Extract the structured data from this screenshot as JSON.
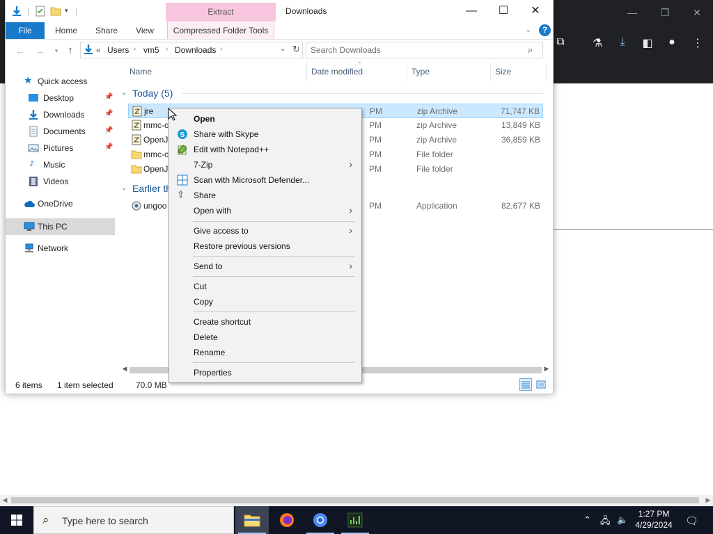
{
  "explorer": {
    "window_title": "Downloads",
    "contextual_tab_header": "Extract",
    "ribbon_tabs": [
      "File",
      "Home",
      "Share",
      "View",
      "Compressed Folder Tools"
    ],
    "help": "?",
    "address": {
      "prefix": "«",
      "segments": [
        "Users",
        "vm5",
        "Downloads"
      ]
    },
    "search_placeholder": "Search Downloads",
    "nav": {
      "quick_access": "Quick access",
      "items": [
        "Desktop",
        "Downloads",
        "Documents",
        "Pictures",
        "Music",
        "Videos"
      ],
      "onedrive": "OneDrive",
      "this_pc": "This PC",
      "network": "Network"
    },
    "columns": [
      "Name",
      "Date modified",
      "Type",
      "Size"
    ],
    "groups": {
      "today": "Today (5)",
      "earlier": "Earlier th"
    },
    "rows": [
      {
        "name": "jre",
        "date": "PM",
        "type": "zip Archive",
        "size": "71,747 KB"
      },
      {
        "name": "mmc-c",
        "date": "PM",
        "type": "zip Archive",
        "size": "13,849 KB"
      },
      {
        "name": "OpenJD",
        "date": "PM",
        "type": "zip Archive",
        "size": "36,859 KB"
      },
      {
        "name": "mmc-c",
        "date": "PM",
        "type": "File folder",
        "size": ""
      },
      {
        "name": "OpenJD",
        "date": "PM",
        "type": "File folder",
        "size": ""
      },
      {
        "name": "ungoo",
        "date": "PM",
        "type": "Application",
        "size": "82,677 KB"
      }
    ],
    "status": {
      "items": "6 items",
      "selected": "1 item selected",
      "size": "70.0 MB"
    }
  },
  "context_menu": {
    "items": [
      "Open",
      "Share with Skype",
      "Edit with Notepad++",
      "7-Zip",
      "Scan with Microsoft Defender...",
      "Share",
      "Open with",
      "Give access to",
      "Restore previous versions",
      "Send to",
      "Cut",
      "Copy",
      "Create shortcut",
      "Delete",
      "Rename",
      "Properties"
    ]
  },
  "taskbar": {
    "search_placeholder": "Type here to search",
    "time": "1:27 PM",
    "date": "4/29/2024"
  },
  "colors": {
    "accent": "#1979ca",
    "selection": "#cce8ff",
    "extract_tab": "#f8c5de",
    "taskbar": "#101624"
  }
}
